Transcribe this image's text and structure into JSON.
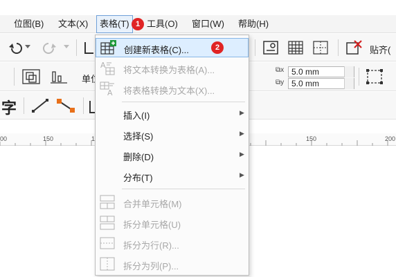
{
  "menubar": {
    "items": [
      {
        "label": "位图(B)"
      },
      {
        "label": "文本(X)"
      },
      {
        "label": "表格(T)"
      },
      {
        "label": "工具(O)"
      },
      {
        "label": "窗口(W)"
      },
      {
        "label": "帮助(H)"
      }
    ]
  },
  "badges": {
    "first": "1",
    "second": "2"
  },
  "toolbar": {
    "unit_label": "单位",
    "paste_label": "贴齐(",
    "x_field": "5.0 mm",
    "y_field": "5.0 mm",
    "text_tool_glyph": "字"
  },
  "ruler": {
    "ticks": [
      "00",
      "150",
      "1",
      "150",
      "200"
    ]
  },
  "dropdown": {
    "items": [
      {
        "label": "创建新表格(C)...",
        "enabled": true,
        "submenu": false,
        "icon": "table-new-icon"
      },
      {
        "label": "将文本转换为表格(A)...",
        "enabled": false,
        "submenu": false,
        "icon": "text-to-table-icon"
      },
      {
        "label": "将表格转换为文本(X)...",
        "enabled": false,
        "submenu": false,
        "icon": "table-to-text-icon"
      },
      {
        "label": "插入(I)",
        "enabled": true,
        "submenu": true
      },
      {
        "label": "选择(S)",
        "enabled": true,
        "submenu": true
      },
      {
        "label": "删除(D)",
        "enabled": true,
        "submenu": true
      },
      {
        "label": "分布(T)",
        "enabled": true,
        "submenu": true
      },
      {
        "label": "合并单元格(M)",
        "enabled": false,
        "submenu": false,
        "icon": "merge-cells-icon"
      },
      {
        "label": "拆分单元格(U)",
        "enabled": false,
        "submenu": false,
        "icon": "split-cells-icon"
      },
      {
        "label": "拆分为行(R)...",
        "enabled": false,
        "submenu": false,
        "icon": "split-rows-icon"
      },
      {
        "label": "拆分为列(P)...",
        "enabled": false,
        "submenu": false,
        "icon": "split-columns-icon"
      }
    ]
  },
  "colors": {
    "accent": "#6fa0d8",
    "badge": "#e02424",
    "highlight": "#ddeeff"
  }
}
